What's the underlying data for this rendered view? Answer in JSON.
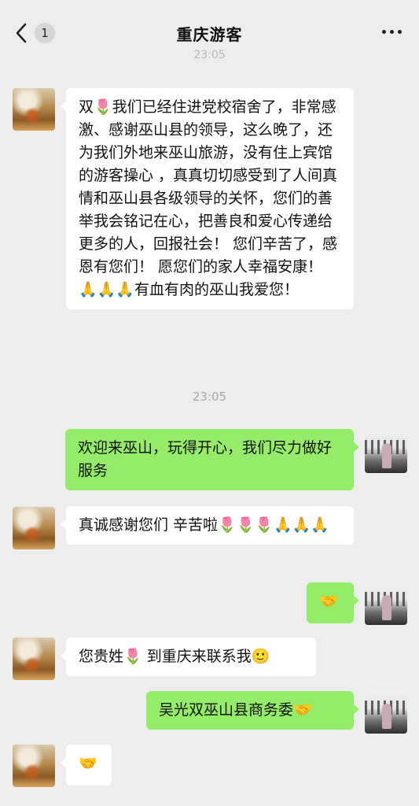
{
  "header": {
    "back_count": "1",
    "title": "重庆游客",
    "faint_time": "23:05"
  },
  "colors": {
    "background": "#ededed",
    "incoming_bubble": "#ffffff",
    "outgoing_bubble": "#95ec69"
  },
  "icons": {
    "back": "chevron-left-icon",
    "more": "more-dots-icon"
  },
  "messages": [
    {
      "side": "in",
      "text": "双🌷我们已经住进党校宿舍了，非常感激、感谢巫山县的领导，这么晚了，还为我们外地来巫山旅游，没有住上宾馆的游客操心 ，真真切切感受到了人间真情和巫山县各级领导的关怀，您们的善举我会铭记在心，把善良和爱心传递给更多的人，回报社会！ 您们辛苦了，感恩有您们！ 愿您们的家人幸福安康！ 🙏🙏🙏有血有肉的巫山我爱您！"
    },
    {
      "time": "23:05"
    },
    {
      "side": "out",
      "text": "欢迎来巫山，玩得开心，我们尽力做好服务"
    },
    {
      "side": "in",
      "text": "真诚感谢您们 辛苦啦🌷🌷🌷🙏🙏🙏"
    },
    {
      "side": "out",
      "text": "🤝"
    },
    {
      "side": "in",
      "text": "您贵姓🌷 到重庆来联系我🙂"
    },
    {
      "side": "out",
      "text": "吴光双巫山县商务委🤝"
    },
    {
      "side": "in",
      "text": "🤝"
    }
  ]
}
